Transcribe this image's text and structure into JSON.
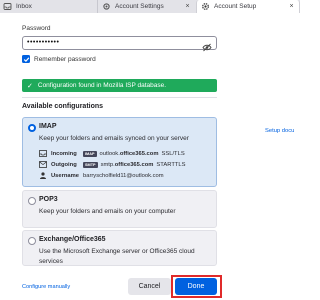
{
  "tabs": [
    {
      "label": "Inbox",
      "icon": "inbox-icon"
    },
    {
      "label": "Account Settings",
      "icon": "settings-icon"
    },
    {
      "label": "Account Setup",
      "icon": "gear-icon",
      "active": true
    }
  ],
  "password": {
    "label": "Password",
    "value": "•••••••••••",
    "show_icon": "eye-off-icon"
  },
  "remember": {
    "label": "Remember password",
    "checked": true
  },
  "banner": {
    "text": "Configuration found in Mozilla ISP database.",
    "color": "#1faa5b"
  },
  "available_heading": "Available configurations",
  "configs": {
    "imap": {
      "title": "IMAP",
      "desc": "Keep your folders and emails synced on your server",
      "selected": true,
      "incoming": {
        "label": "Incoming",
        "protocol": "IMAP",
        "host_pre": "outlook.",
        "host_bold": "office365.com",
        "security": "SSL/TLS"
      },
      "outgoing": {
        "label": "Outgoing",
        "protocol": "SMTP",
        "host_pre": "smtp.",
        "host_bold": "office365.com",
        "security": "STARTTLS"
      },
      "username": {
        "label": "Username",
        "value": "barryscholfield11@outlook.com"
      }
    },
    "pop3": {
      "title": "POP3",
      "desc": "Keep your folders and emails on your computer",
      "selected": false
    },
    "exchange": {
      "title": "Exchange/Office365",
      "desc": "Use the Microsoft Exchange server or Office365 cloud services",
      "selected": false
    }
  },
  "links": {
    "setup_doc": "Setup docu",
    "configure_manually": "Configure manually"
  },
  "buttons": {
    "cancel": "Cancel",
    "done": "Done"
  },
  "colors": {
    "accent": "#0061e0",
    "highlight_frame": "#e02a2a"
  }
}
